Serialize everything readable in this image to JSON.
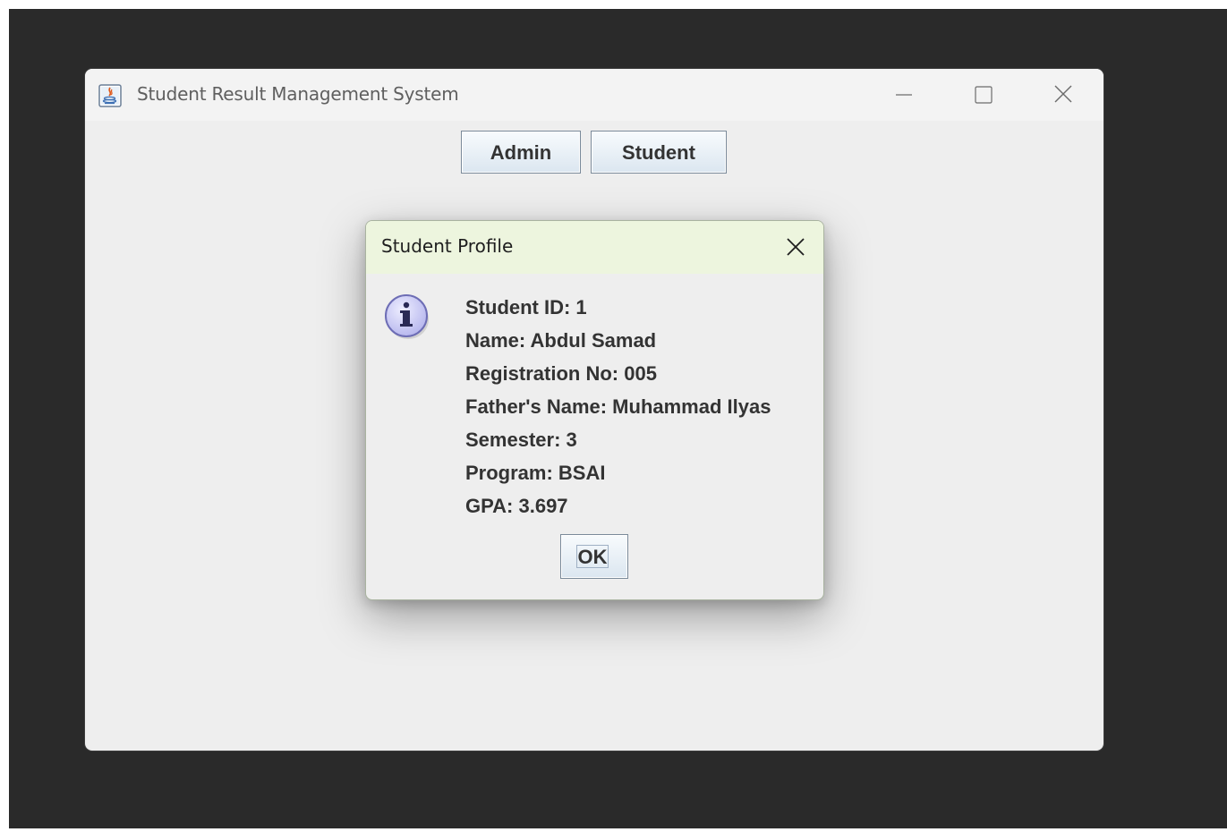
{
  "window": {
    "title": "Student Result Management System",
    "controls": {
      "minimize_icon": "minimize-icon",
      "maximize_icon": "maximize-icon",
      "close_icon": "close-icon"
    }
  },
  "toolbar": {
    "admin_label": "Admin",
    "student_label": "Student"
  },
  "dialog": {
    "title": "Student Profile",
    "icon": "info-icon",
    "lines": [
      "Student ID: 1",
      "Name: Abdul Samad",
      "Registration No: 005",
      "Father's Name: Muhammad Ilyas",
      "Semester: 3",
      "Program: BSAI",
      "GPA: 3.697"
    ],
    "ok_label": "OK"
  },
  "colors": {
    "desktop": "#2a2a2a",
    "window_bg": "#eeeeee",
    "dialog_titlebar": "#edf5de",
    "button_gradient_top": "#f8fbfd",
    "button_gradient_bottom": "#dbe6f0",
    "info_icon_fill": "#c9c9f5",
    "info_icon_border": "#6d6db5"
  }
}
